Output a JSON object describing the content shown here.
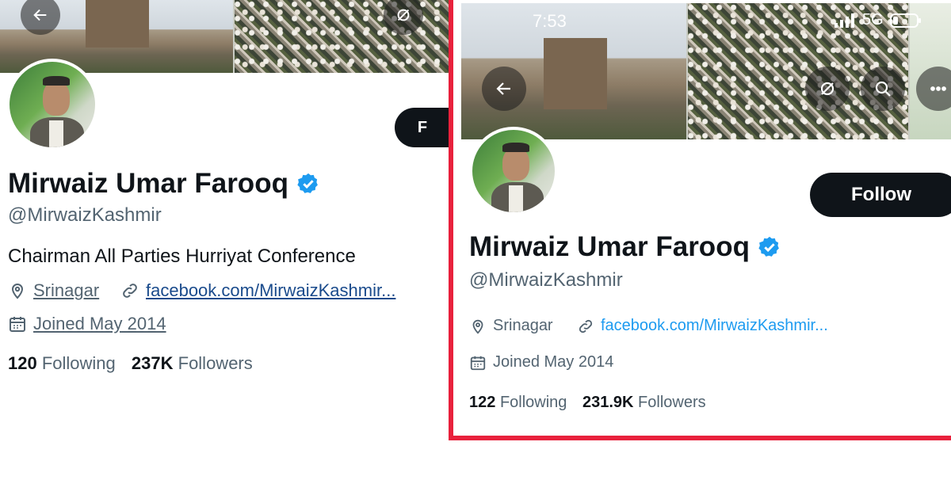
{
  "left": {
    "name": "Mirwaiz Umar Farooq",
    "handle": "@MirwaizKashmir",
    "bio": "Chairman All Parties Hurriyat Conference",
    "location": "Srinagar",
    "website": "facebook.com/MirwaizKashmir...",
    "joined": "Joined May 2014",
    "following_count": "120",
    "following_label": "Following",
    "followers_count": "237K",
    "followers_label": "Followers",
    "follow_label": "F"
  },
  "right": {
    "status": {
      "time": "7:53",
      "network": "5G"
    },
    "name": "Mirwaiz Umar Farooq",
    "handle": "@MirwaizKashmir",
    "location": "Srinagar",
    "website": "facebook.com/MirwaizKashmir...",
    "joined": "Joined May 2014",
    "following_count": "122",
    "following_label": "Following",
    "followers_count": "231.9K",
    "followers_label": "Followers",
    "follow_label": "Follow"
  },
  "colors": {
    "highlight_border": "#e8213c",
    "verified": "#1d9bf0",
    "link": "#1d9bf0",
    "button": "#0f1419"
  },
  "icons": [
    "back-arrow-icon",
    "mute-icon",
    "search-icon",
    "more-icon",
    "location-icon",
    "link-icon",
    "calendar-icon",
    "verified-badge-icon"
  ]
}
